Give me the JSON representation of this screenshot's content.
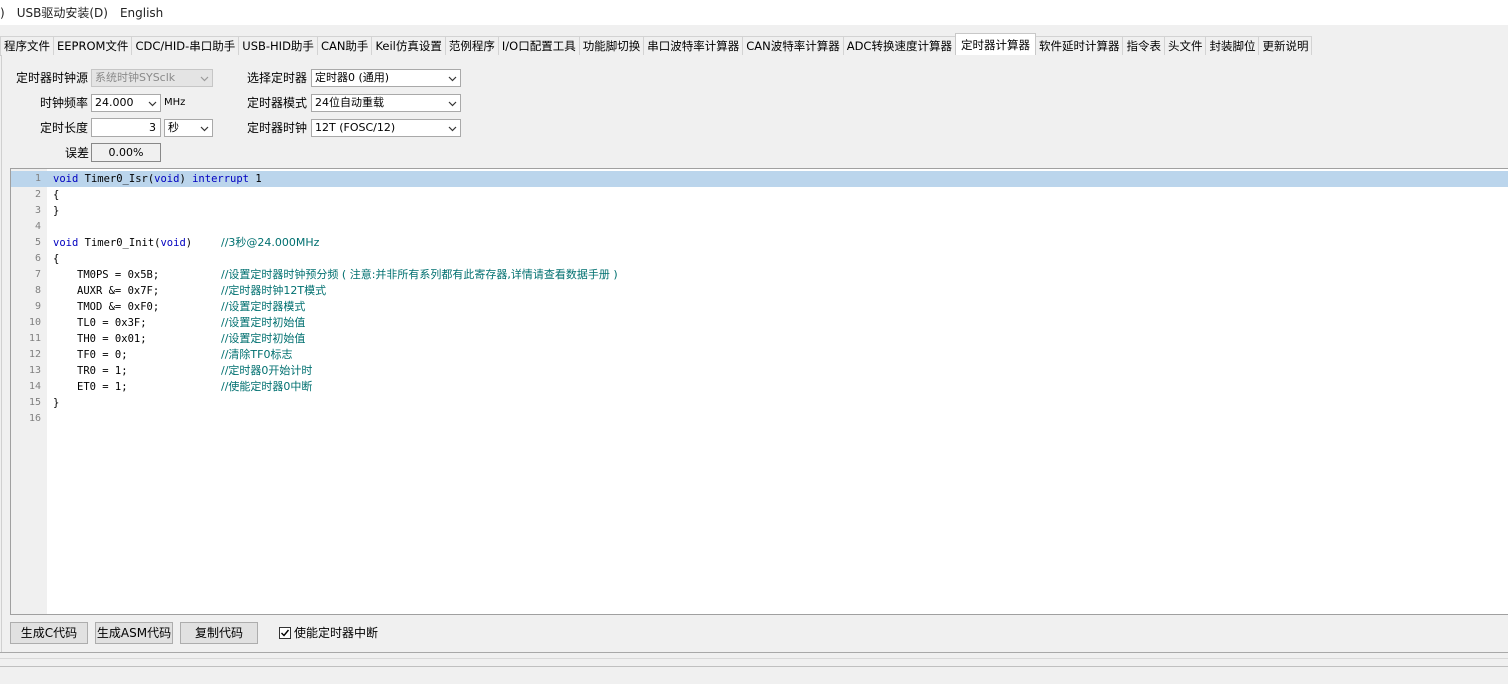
{
  "menu": {
    "items": [
      ")",
      "USB驱动安装(D)",
      "English"
    ]
  },
  "tabs": [
    "程序文件",
    "EEPROM文件",
    "CDC/HID-串口助手",
    "USB-HID助手",
    "CAN助手",
    "Keil仿真设置",
    "范例程序",
    "I/O口配置工具",
    "功能脚切换",
    "串口波特率计算器",
    "CAN波特率计算器",
    "ADC转换速度计算器",
    "定时器计算器",
    "软件延时计算器",
    "指令表",
    "头文件",
    "封装脚位",
    "更新说明"
  ],
  "active_tab_index": 12,
  "form": {
    "clock_source_label": "定时器时钟源",
    "clock_source_value": "系统时钟SYSclk",
    "freq_label": "时钟频率",
    "freq_value": "24.000",
    "freq_unit": "MHz",
    "length_label": "定时长度",
    "length_value": "3",
    "length_unit": "秒",
    "error_label": "误差",
    "error_value": "0.00%",
    "timer_select_label": "选择定时器",
    "timer_select_value": "定时器0 (通用)",
    "timer_mode_label": "定时器模式",
    "timer_mode_value": "24位自动重载",
    "timer_clock_label": "定时器时钟",
    "timer_clock_value": "12T (FOSC/12)"
  },
  "code_lines": [
    {
      "n": "1",
      "code": "void Timer0_Isr(void) interrupt 1",
      "comment": ""
    },
    {
      "n": "2",
      "code": "{",
      "comment": ""
    },
    {
      "n": "3",
      "code": "}",
      "comment": ""
    },
    {
      "n": "4",
      "code": "",
      "comment": ""
    },
    {
      "n": "5",
      "code": "void Timer0_Init(void)",
      "comment": "//3秒@24.000MHz"
    },
    {
      "n": "6",
      "code": "{",
      "comment": ""
    },
    {
      "n": "7",
      "code": "TM0PS = 0x5B;",
      "comment": "//设置定时器时钟预分频 ( 注意:并非所有系列都有此寄存器,详情请查看数据手册 )"
    },
    {
      "n": "8",
      "code": "AUXR &= 0x7F;",
      "comment": "//定时器时钟12T模式"
    },
    {
      "n": "9",
      "code": "TMOD &= 0xF0;",
      "comment": "//设置定时器模式"
    },
    {
      "n": "10",
      "code": "TL0 = 0x3F;",
      "comment": "//设置定时初始值"
    },
    {
      "n": "11",
      "code": "TH0 = 0x01;",
      "comment": "//设置定时初始值"
    },
    {
      "n": "12",
      "code": "TF0 = 0;",
      "comment": "//清除TF0标志"
    },
    {
      "n": "13",
      "code": "TR0 = 1;",
      "comment": "//定时器0开始计时"
    },
    {
      "n": "14",
      "code": "ET0 = 1;",
      "comment": "//使能定时器0中断"
    },
    {
      "n": "15",
      "code": "}",
      "comment": ""
    },
    {
      "n": "16",
      "code": "",
      "comment": ""
    }
  ],
  "buttons": {
    "gen_c": "生成C代码",
    "gen_asm": "生成ASM代码",
    "copy": "复制代码"
  },
  "checkbox": {
    "label": "使能定时器中断",
    "checked": true
  },
  "icons": {
    "dropdown": "chevron-down-icon",
    "check": "checkmark-icon"
  }
}
